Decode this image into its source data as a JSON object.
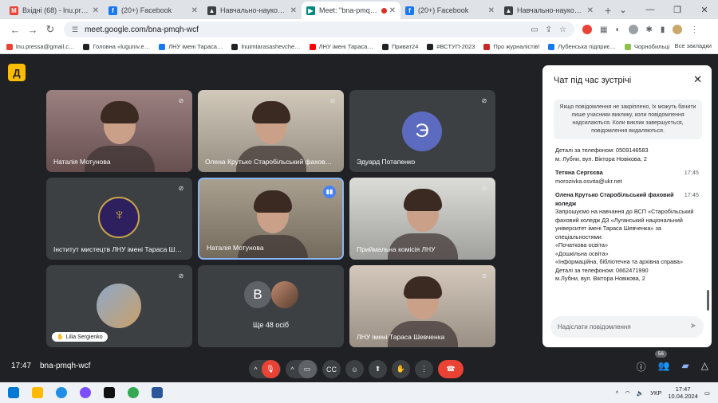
{
  "tabs": [
    {
      "title": "Вхідні (68) - lnu.press…",
      "fav_color": "#ea4335",
      "fav_letter": "M"
    },
    {
      "title": "(20+) Facebook",
      "fav_color": "#1877f2",
      "fav_letter": "f"
    },
    {
      "title": "Навчально-науковий інс…",
      "fav_color": "#3c4043",
      "fav_letter": "▲"
    },
    {
      "title": "Meet: \"bna-pmqh-wcf\"",
      "fav_color": "#00897b",
      "fav_letter": "▶",
      "active": true
    },
    {
      "title": "(20+) Facebook",
      "fav_color": "#1877f2",
      "fav_letter": "f"
    },
    {
      "title": "Навчально-науковий інс…",
      "fav_color": "#3c4043",
      "fav_letter": "▲"
    }
  ],
  "address": {
    "url": "meet.google.com/bna-pmqh-wcf"
  },
  "bookmarks": [
    {
      "label": "lnu.pressa@gmail.c…",
      "color": "#ea4335"
    },
    {
      "label": "Головна «luguniv.e…",
      "color": "#202124"
    },
    {
      "label": "ЛНУ імені Тараса…",
      "color": "#1877f2"
    },
    {
      "label": "lnuimtarasashevche…",
      "color": "#202124"
    },
    {
      "label": "ЛНУ імені Тараса…",
      "color": "#ff0000"
    },
    {
      "label": "Приват24",
      "color": "#202124"
    },
    {
      "label": "#ВСТУП-2023",
      "color": "#202124"
    },
    {
      "label": "Про журналістів!",
      "color": "#c62828"
    },
    {
      "label": "Лубенська підприє…",
      "color": "#1877f2"
    },
    {
      "label": "Чорнобильці",
      "color": "#8bc34a"
    }
  ],
  "bookmarks_all": "Все закладки",
  "meet": {
    "logo_letter": "Д",
    "tiles": [
      {
        "name": "Наталія Мотунова",
        "kind": "photo",
        "bg": "#8a6a6a"
      },
      {
        "name": "Олена Крутько Старобільський фахов…",
        "kind": "photo",
        "bg": "#c9bfae"
      },
      {
        "name": "Эдуард Потапенко",
        "kind": "avatar",
        "letter": "Э"
      },
      {
        "name": "Інститут мистецтв ЛНУ імені Тараса Ш…",
        "kind": "emblem",
        "bg": "#2f3236"
      },
      {
        "name": "Наталія Мотунова",
        "kind": "photo",
        "bg": "#9a8f7c",
        "speaking": true
      },
      {
        "name": "Приймальна комісія ЛНУ",
        "kind": "photo",
        "bg": "#d6d6d2"
      },
      {
        "name": "Lilia Sergienko",
        "kind": "portrait",
        "bg": "#3c4043"
      },
      {
        "name": "Ще 48 осіб",
        "kind": "others",
        "letter": "В"
      },
      {
        "name": "ЛНУ імені Тараса Шевченка",
        "kind": "photo",
        "bg": "#cdbfb0"
      }
    ]
  },
  "chat": {
    "title": "Чат під час зустрічі",
    "notice": "Якщо повідомлення не закріплено, їх можуть бачити лише учасники виклику, коли повідомлення надсилаються. Коли виклик завершується, повідомлення видаляються.",
    "pre_lines": [
      "Деталі за телефоном: 0509146583",
      "м. Лубни, вул. Віктора Новікова, 2"
    ],
    "messages": [
      {
        "sender": "Тетяна Сергєєва",
        "time": "17:45",
        "lines": [
          "morozivka.osvita@ukr.net"
        ]
      },
      {
        "sender": "Олена Крутько Старобільський фаховий коледж",
        "time": "17:45",
        "lines": [
          "Запрошуємо на навчання до ВСП «Старобільський фаховий коледж ДЗ «Луганський національний університет імені Тараса Шевченка» за спеціальностями:",
          "«Початкова освіта»",
          "«Дошкільна освіта»",
          "«Інформаційна, бібліотечна та архівна справа»",
          "Деталі за телефоном: 0662471990",
          "м.Лубни, вул. Віктора Новікова, 2"
        ]
      }
    ],
    "input_placeholder": "Надіслати повідомлення"
  },
  "bottom": {
    "time": "17:47",
    "code": "bna-pmqh-wcf",
    "participants": "56"
  },
  "taskbar": {
    "lang": "УКР",
    "time": "17:47",
    "date": "10.04.2024"
  }
}
